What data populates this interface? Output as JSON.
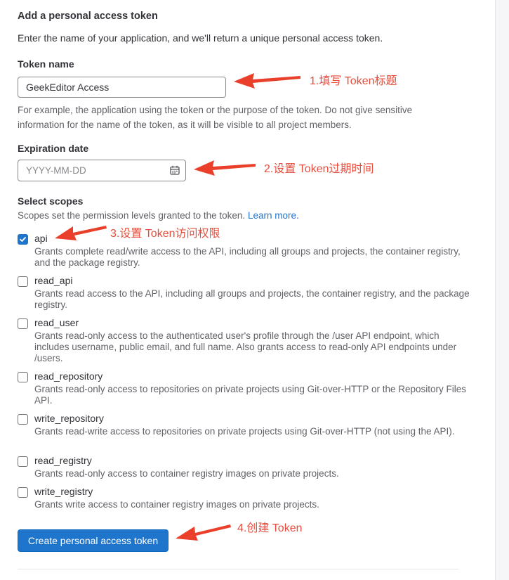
{
  "form": {
    "title": "Add a personal access token",
    "description": "Enter the name of your application, and we'll return a unique personal access token.",
    "token_name": {
      "label": "Token name",
      "value": "GeekEditor Access",
      "help_line1": "For example, the application using the token or the purpose of the token. Do not give sensitive",
      "help_line2": "information for the name of the token, as it will be visible to all project members."
    },
    "expiration": {
      "label": "Expiration date",
      "placeholder": "YYYY-MM-DD",
      "icon": "calendar-icon"
    },
    "scopes": {
      "label": "Select scopes",
      "description": "Scopes set the permission levels granted to the token.",
      "learn_more": "Learn more.",
      "items": [
        {
          "name": "api",
          "checked": true,
          "description": "Grants complete read/write access to the API, including all groups and projects, the container registry, and the package registry."
        },
        {
          "name": "read_api",
          "checked": false,
          "description": "Grants read access to the API, including all groups and projects, the container registry, and the package registry."
        },
        {
          "name": "read_user",
          "checked": false,
          "description": "Grants read-only access to the authenticated user's profile through the /user API endpoint, which includes username, public email, and full name. Also grants access to read-only API endpoints under /users."
        },
        {
          "name": "read_repository",
          "checked": false,
          "description": "Grants read-only access to repositories on private projects using Git-over-HTTP or the Repository Files API."
        },
        {
          "name": "write_repository",
          "checked": false,
          "description": "Grants read-write access to repositories on private projects using Git-over-HTTP (not using the API)."
        },
        {
          "name": "read_registry",
          "checked": false,
          "description": "Grants read-only access to container registry images on private projects."
        },
        {
          "name": "write_registry",
          "checked": false,
          "description": "Grants write access to container registry images on private projects."
        }
      ]
    },
    "submit_label": "Create personal access token"
  },
  "annotations": {
    "step1": "1.填写 Token标题",
    "step2": "2.设置 Token过期时间",
    "step3": "3.设置 Token访问权限",
    "step4": "4.创建 Token"
  },
  "colors": {
    "primary": "#1f75cb",
    "annotation": "#e74c3c",
    "text": "#333238",
    "muted": "#626168"
  }
}
